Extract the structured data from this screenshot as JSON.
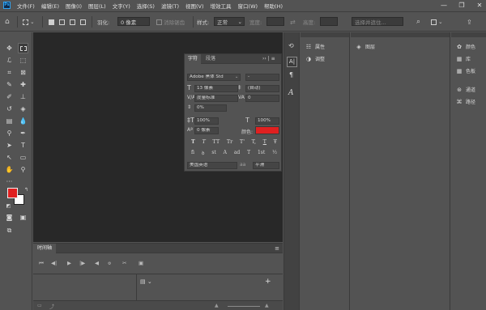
{
  "menu": {
    "logo": "Ps",
    "items": [
      "文件(F)",
      "编辑(E)",
      "图像(I)",
      "图层(L)",
      "文字(Y)",
      "选择(S)",
      "滤镜(T)",
      "视图(V)",
      "增效工具",
      "窗口(W)",
      "帮助(H)"
    ],
    "window_controls": [
      "—",
      "❐",
      "✕"
    ]
  },
  "options": {
    "feather_label": "羽化:",
    "feather_value": "0 像素",
    "antialias_label": "消除锯齿",
    "style_label": "样式:",
    "style_value": "正常",
    "width_label": "宽度:",
    "height_label": "高度:",
    "select_mask_button": "选择并遮住..."
  },
  "canvas": {
    "background": "#282828"
  },
  "character_panel": {
    "tab_active": "字符",
    "tab_inactive": "段落",
    "menu_glyphs": "›› | ≡",
    "font_family": "Adobe 黑体 Std",
    "font_style": "-",
    "font_size": "13 像素",
    "leading": "(自动)",
    "kerning": "度量标准",
    "tracking": "0",
    "baseline_shift_pct": "0%",
    "vertical_scale": "100%",
    "horizontal_scale": "100%",
    "baseline_shift": "0 像素",
    "color_label": "颜色:",
    "text_color": "#e02020",
    "type_styles": [
      "T",
      "T",
      "TT",
      "Tr",
      "T'",
      "T,",
      "T",
      "Ŧ"
    ],
    "opentype": [
      "fi",
      "ꝺ",
      "st",
      "A",
      "ad",
      "T",
      "1st",
      "½"
    ],
    "language": "美国英语",
    "antialias": "平滑",
    "antialias_icon": "aa"
  },
  "timeline": {
    "tab": "时间轴",
    "controls": [
      "⏮",
      "◀|",
      "▶",
      "|▶",
      "◀",
      "✂",
      "▣"
    ],
    "add_button": "+"
  },
  "properties_panel": {
    "items": [
      {
        "icon": "properties-icon",
        "label": "属性"
      },
      {
        "icon": "adjustments-icon",
        "label": "调整"
      }
    ]
  },
  "layers_panel": {
    "label": "图层"
  },
  "right_panel": {
    "items": [
      {
        "icon": "color-icon",
        "label": "颜色"
      },
      {
        "icon": "library-icon",
        "label": "库"
      },
      {
        "icon": "swatches-icon",
        "label": "色板"
      },
      {
        "icon": "channels-icon",
        "label": "通道"
      },
      {
        "icon": "paths-icon",
        "label": "路径"
      }
    ]
  },
  "colors": {
    "foreground": "#e02020",
    "background": "#ffffff",
    "accent": "#2fa3f2"
  }
}
